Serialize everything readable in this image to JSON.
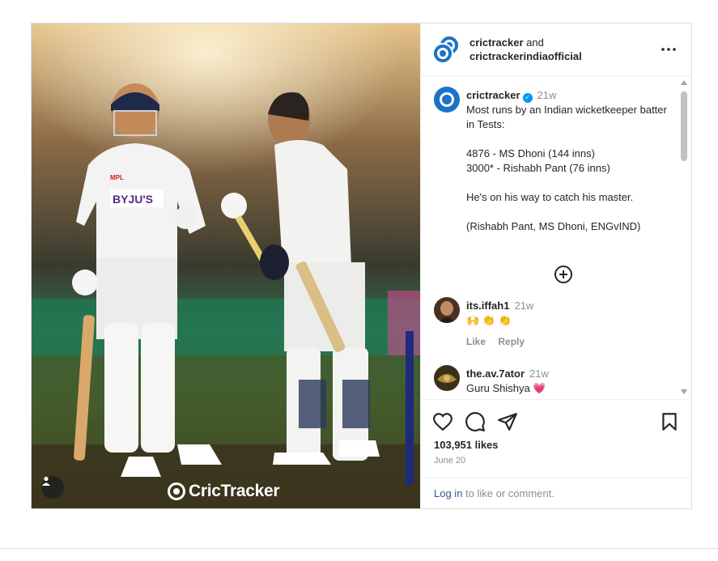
{
  "media": {
    "watermark": "CricTracker",
    "player_shirt_logo": "BYJU'S",
    "shirt_badge": "MPL"
  },
  "header": {
    "user1": "crictracker",
    "and_text": "and",
    "user2": "crictrackerindiaofficial"
  },
  "caption": {
    "username": "crictracker",
    "verified_mark": "✓",
    "age": "21w",
    "text": "Most runs by an Indian wicketkeeper batter in Tests:\n\n4876 - MS Dhoni (144 inns)\n3000* - Rishabh Pant (76 inns)\n\nHe's on his way to catch his master.\n\n(Rishabh Pant, MS Dhoni, ENGvIND)"
  },
  "comments": [
    {
      "username": "its.iffah1",
      "age": "21w",
      "text": "🙌 👏 👏",
      "like": "Like",
      "reply": "Reply"
    },
    {
      "username": "the.av.7ator",
      "age": "21w",
      "text": "Guru Shishya 💗"
    }
  ],
  "post_footer": {
    "likes": "103,951 likes",
    "date": "June 20",
    "login_link": "Log in",
    "login_rest": " to like or comment."
  },
  "colors": {
    "accent_blue": "#0095f6",
    "brand_blue": "#1b73c7",
    "link": "#385898",
    "heart": "#e0245e"
  },
  "icons": [
    "more-icon",
    "verified-icon",
    "load-more-icon",
    "heart-icon",
    "comment-icon",
    "share-icon",
    "bookmark-icon",
    "user-tag-icon"
  ]
}
